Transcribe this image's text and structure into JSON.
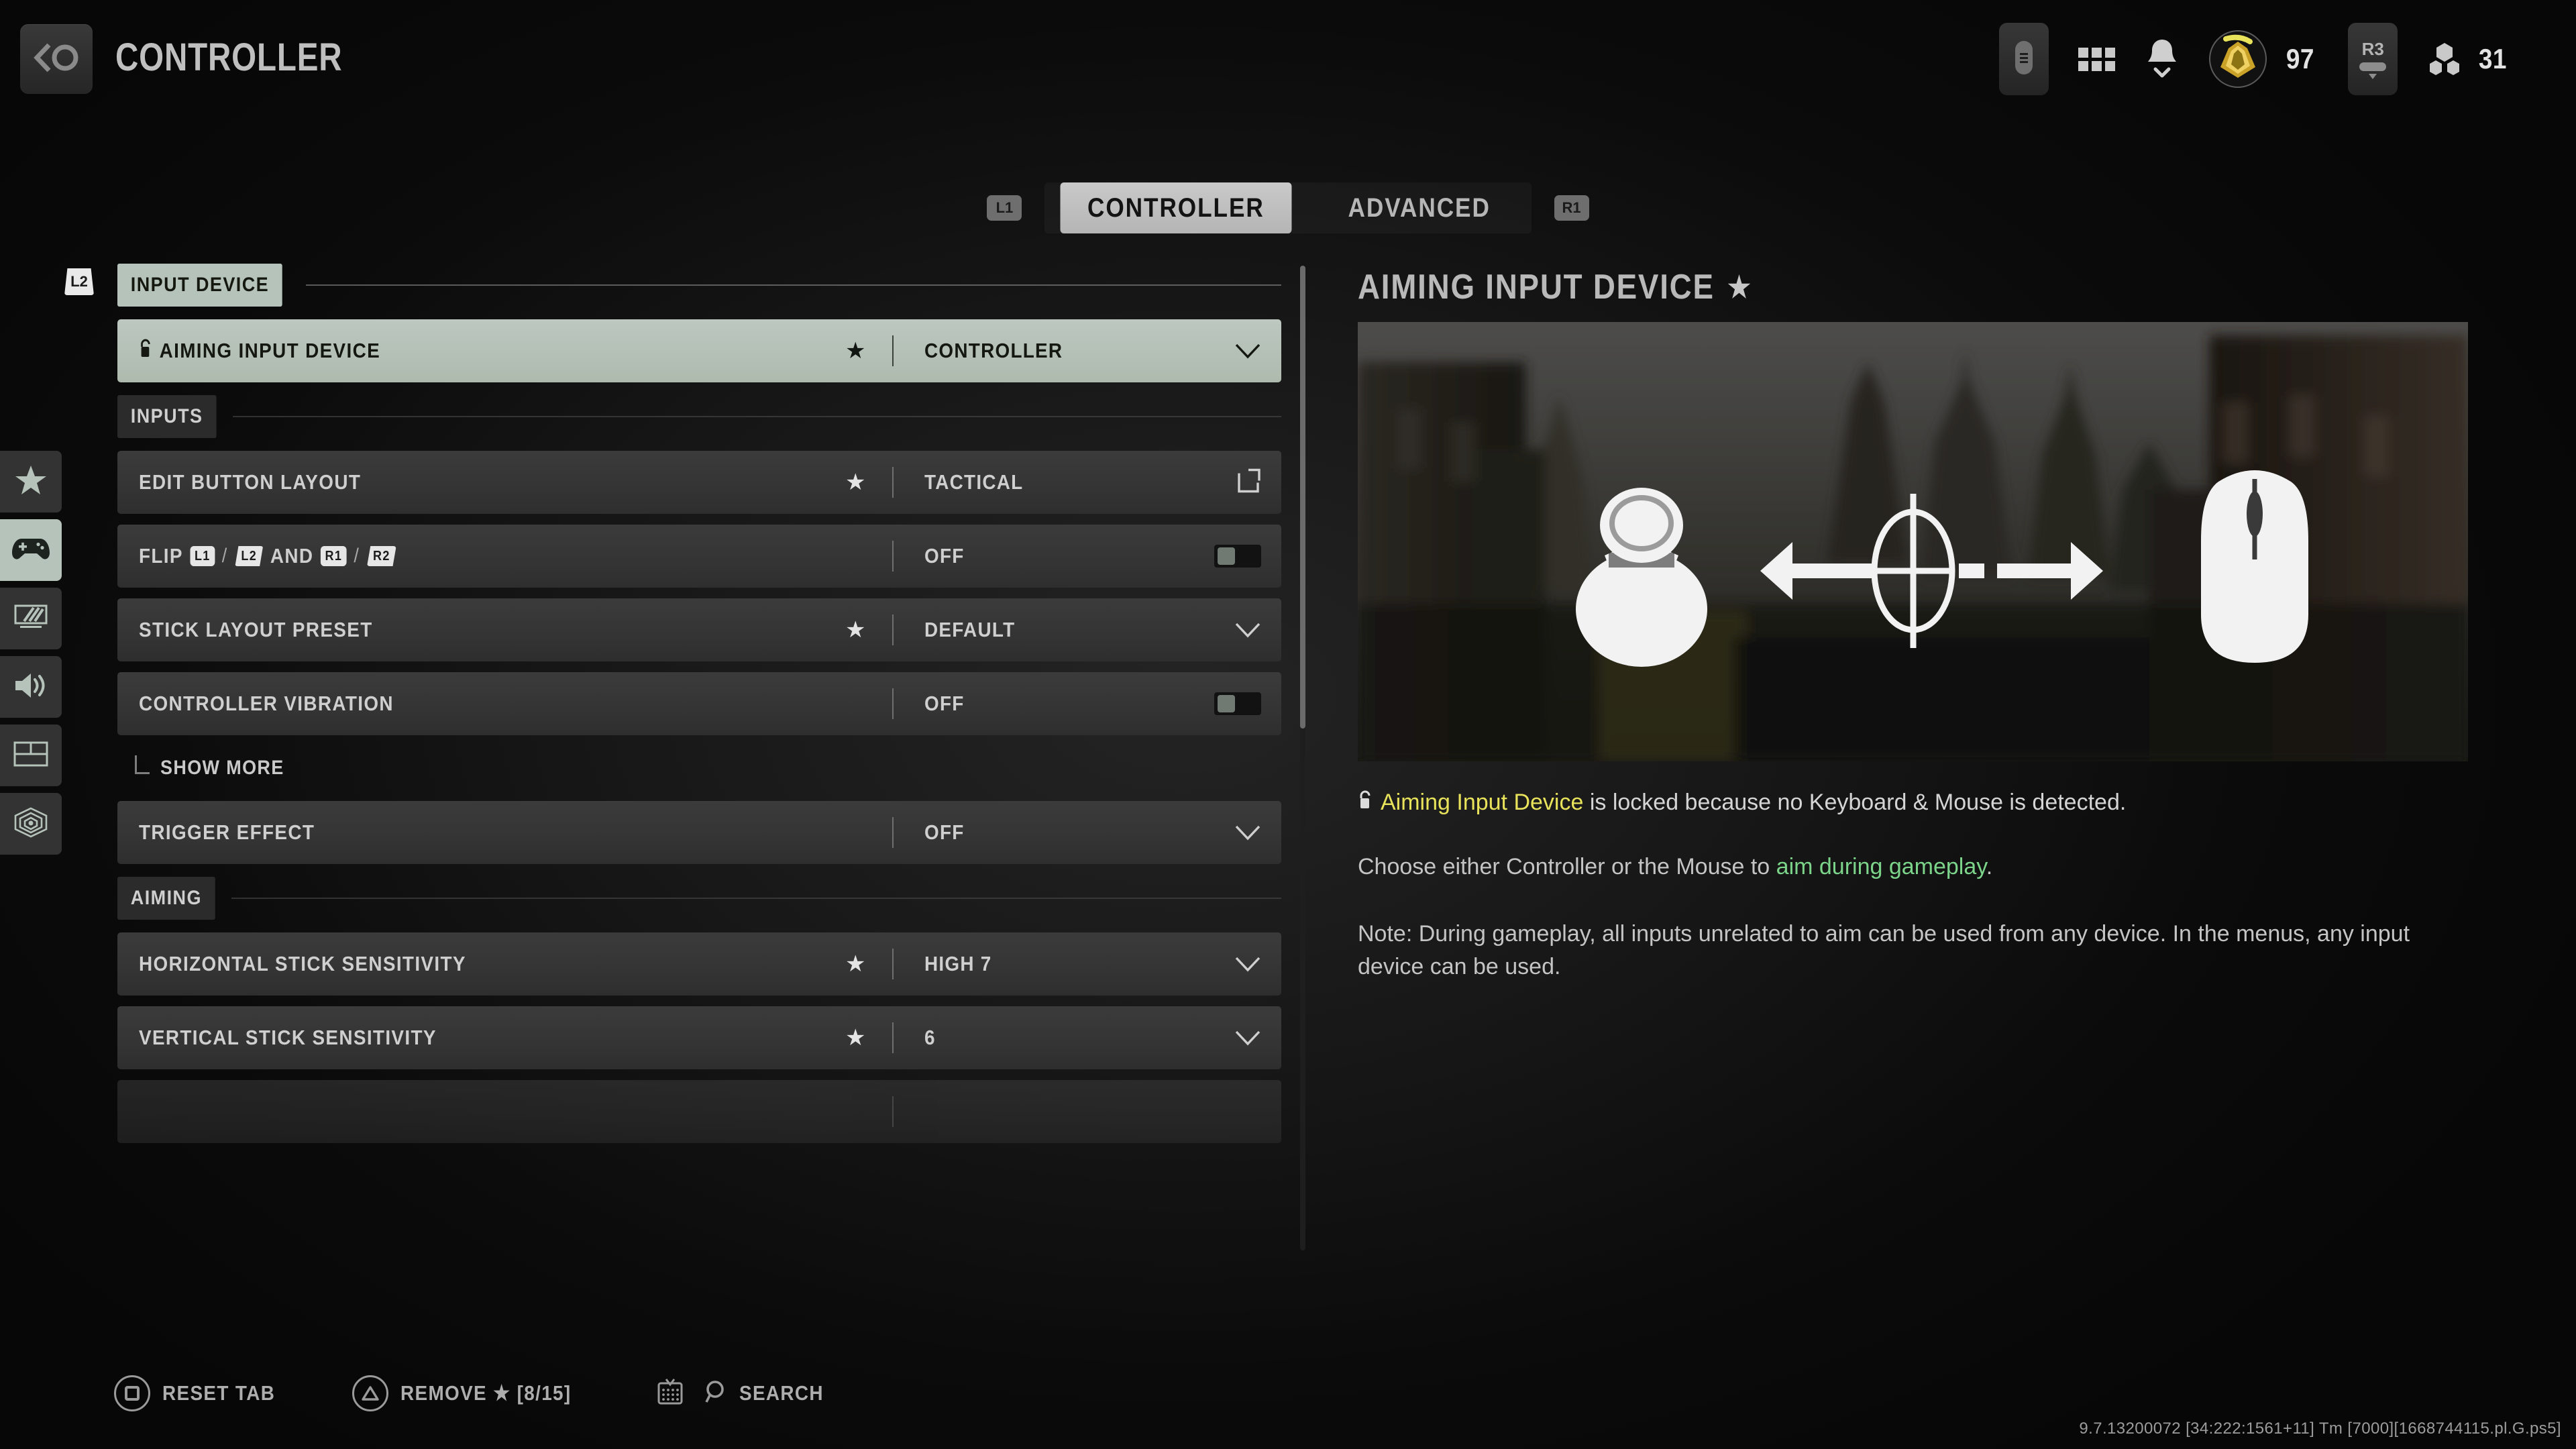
{
  "header": {
    "title": "CONTROLLER",
    "back_icon": "back-circle-icon",
    "right": {
      "battery_icon": "controller-battery-icon",
      "apps_icon": "apps-grid-icon",
      "notifications_icon": "bell-icon",
      "rank_icon": "prestige-emblem-icon",
      "rank_value": "97",
      "r3_label": "R3",
      "squad_icon": "squad-icon",
      "squad_value": "31"
    }
  },
  "tabs": {
    "left_shoulder": "L1",
    "right_shoulder": "R1",
    "items": [
      {
        "label": "CONTROLLER",
        "active": true
      },
      {
        "label": "ADVANCED",
        "active": false
      }
    ]
  },
  "rail": {
    "l2_hint": "L2",
    "items": [
      {
        "name": "favorites",
        "icon": "star-icon",
        "active": false
      },
      {
        "name": "controller",
        "icon": "gamepad-icon",
        "active": true
      },
      {
        "name": "graphics",
        "icon": "monitor-icon",
        "active": false
      },
      {
        "name": "audio",
        "icon": "speaker-icon",
        "active": false
      },
      {
        "name": "interface",
        "icon": "layout-icon",
        "active": false
      },
      {
        "name": "accessibility",
        "icon": "accessibility-icon",
        "active": false
      }
    ]
  },
  "settings": {
    "sections": [
      {
        "title": "INPUT DEVICE",
        "highlighted": true
      },
      {
        "title": "INPUTS",
        "highlighted": false
      },
      {
        "title": "AIMING",
        "highlighted": false
      }
    ],
    "rows": {
      "aiming_input_device": {
        "label": "AIMING INPUT DEVICE",
        "value": "CONTROLLER",
        "star": "★",
        "lock_icon": "lock-icon",
        "control": "dropdown",
        "selected": true
      },
      "edit_button_layout": {
        "label": "EDIT BUTTON LAYOUT",
        "value": "TACTICAL",
        "star": "★",
        "control": "open-external"
      },
      "flip": {
        "label_prefix": "FLIP",
        "badge_1": "L1",
        "sep_1": "/",
        "badge_2": "L2",
        "label_mid": "AND",
        "badge_3": "R1",
        "sep_2": "/",
        "badge_4": "R2",
        "value": "OFF",
        "control": "toggle",
        "toggle_on": false
      },
      "stick_layout_preset": {
        "label": "STICK LAYOUT PRESET",
        "value": "DEFAULT",
        "star": "★",
        "control": "dropdown"
      },
      "controller_vibration": {
        "label": "CONTROLLER VIBRATION",
        "value": "OFF",
        "control": "toggle",
        "toggle_on": false
      },
      "show_more": {
        "label": "SHOW MORE"
      },
      "trigger_effect": {
        "label": "TRIGGER EFFECT",
        "value": "OFF",
        "control": "dropdown"
      },
      "horizontal_stick_sensitivity": {
        "label": "HORIZONTAL STICK SENSITIVITY",
        "value": "HIGH 7",
        "star": "★",
        "control": "dropdown"
      },
      "vertical_stick_sensitivity": {
        "label": "VERTICAL STICK SENSITIVITY",
        "value": "6",
        "star": "★",
        "control": "dropdown"
      }
    }
  },
  "detail": {
    "title": "AIMING INPUT DEVICE",
    "title_star": "★",
    "image_alt": "analog-stick-crosshair-mouse-illustration",
    "lock_icon": "lock-icon",
    "lock_highlight": "Aiming Input Device",
    "lock_text": " is locked because no Keyboard & Mouse is detected.",
    "desc_pre": "Choose either Controller or the Mouse to ",
    "desc_green": "aim during gameplay",
    "desc_post": ".",
    "note": "Note: During gameplay, all inputs unrelated to aim can be used from any device. In the menus, any input device can be used."
  },
  "footer": {
    "buttons": [
      {
        "icon": "square-button-icon",
        "label": "RESET TAB"
      },
      {
        "icon": "triangle-button-icon",
        "label": "REMOVE ★ [8/15]"
      },
      {
        "icon": "touchpad-icon",
        "label": "SEARCH"
      }
    ],
    "version": "9.7.13200072 [34:222:1561+11] Tm [7000][1668744115.pl.G.ps5]"
  },
  "colors": {
    "accent_light": "#b6c3bb",
    "warning": "#e8e35a",
    "link_green": "#7bd48a",
    "row_bg": "#343434",
    "page_bg": "#0a0a0a"
  }
}
